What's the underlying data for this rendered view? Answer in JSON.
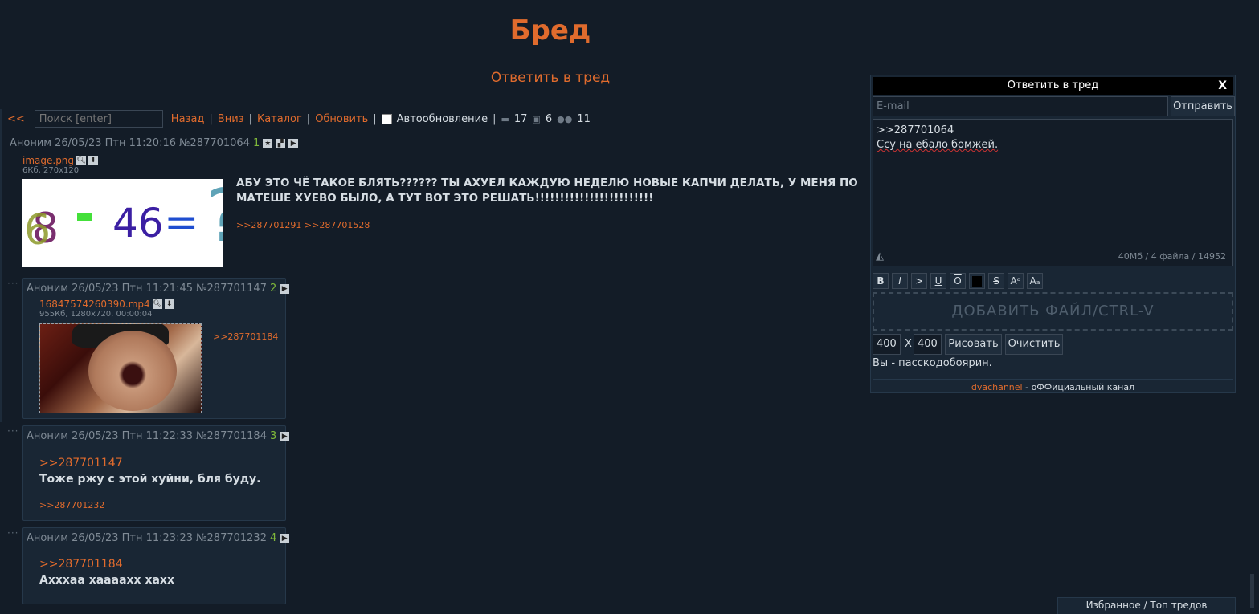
{
  "board": {
    "title": "Бред",
    "reply_link": "Ответить в тред"
  },
  "topbar": {
    "back": "<<",
    "search_placeholder": "Поиск [enter]",
    "nav": [
      "Назад",
      "Вниз",
      "Каталог",
      "Обновить"
    ],
    "separator": "|",
    "autoupdate_label": "Автообновление",
    "stats": {
      "posts": "17",
      "images": "6",
      "users": "11"
    }
  },
  "op": {
    "author": "Аноним",
    "date": "26/05/23 Птн 11:20:16",
    "id": "№287701064",
    "num": "1",
    "file": {
      "name": "image.png",
      "meta": "6Кб, 270x120"
    },
    "text": "АБУ ЭТО ЧЁ ТАКОЕ БЛЯТЬ?????? ТЫ АХУЕЛ КАЖДУЮ НЕДЕЛЮ НОВЫЕ КАПЧИ ДЕЛАТЬ, У МЕНЯ ПО МАТЕШЕ ХУЕВО БЫЛО, А ТУТ ВОТ ЭТО РЕШАТЬ!!!!!!!!!!!!!!!!!!!!!!!!",
    "replies": ">>287701291 >>287701528",
    "captcha": {
      "a": "8",
      "b": "6",
      "c": "46",
      "op": "-",
      "eq": "=",
      "q": "?"
    }
  },
  "posts": [
    {
      "author": "Аноним",
      "date": "26/05/23 Птн 11:21:45",
      "id": "№287701147",
      "num": "2",
      "file": {
        "name": "16847574260390.mp4",
        "meta": "955Кб, 1280x720, 00:00:04"
      },
      "replies": ">>287701184"
    },
    {
      "author": "Аноним",
      "date": "26/05/23 Птн 11:22:33",
      "id": "№287701184",
      "num": "3",
      "quote": ">>287701147",
      "body": "Тоже ржу с этой хуйни, бля буду.",
      "replies": ">>287701232"
    },
    {
      "author": "Аноним",
      "date": "26/05/23 Птн 11:23:23",
      "id": "№287701232",
      "num": "4",
      "quote": ">>287701184",
      "body": "Ахххаа хааааxх хахх"
    }
  ],
  "form": {
    "title": "Ответить в тред",
    "close": "X",
    "email_placeholder": "E-mail",
    "send": "Отправить",
    "text_line1": ">>287701064",
    "text_line2": "Ссу на ебало бомжей.",
    "limits": "40Мб / 4 файла / 14952",
    "format_buttons": [
      "B",
      "I",
      ">",
      "U",
      "O",
      "",
      "S",
      "Aᵃ",
      "Aₐ"
    ],
    "dropzone": "ДОБАВИТЬ ФАЙЛ/CTRL-V",
    "width": "400",
    "height": "400",
    "x_label": "X",
    "draw": "Рисовать",
    "clear": "Очистить",
    "status": "Вы - пасскодобоярин.",
    "footer_channel": "dvachannel",
    "footer_text": " - оФФициальный канал"
  },
  "bottom_tab": "Избранное / Топ тредов",
  "colors": {
    "accent": "#e06b2d",
    "bg": "#131c27",
    "post_bg": "#192634",
    "num": "#7fb83a"
  }
}
